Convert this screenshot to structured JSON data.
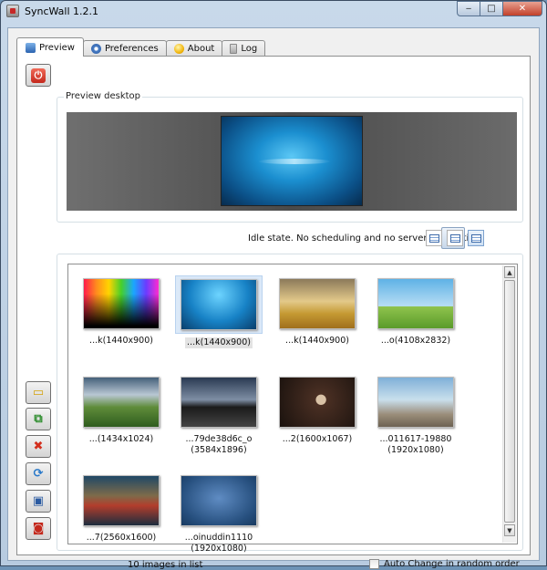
{
  "window": {
    "title": "SyncWall 1.2.1",
    "min": "‒",
    "max": "□",
    "close": "✕"
  },
  "tabs": [
    {
      "label": "Preview",
      "icon": "preview-icon"
    },
    {
      "label": "Preferences",
      "icon": "preferences-icon"
    },
    {
      "label": "About",
      "icon": "about-icon"
    },
    {
      "label": "Log",
      "icon": "log-icon"
    }
  ],
  "preview": {
    "group_label": "Preview desktop"
  },
  "status": {
    "text": "Idle state. No scheduling and no server connection"
  },
  "images": [
    {
      "caption": "...k(1440x900)",
      "selected": false
    },
    {
      "caption": "...k(1440x900)",
      "selected": true
    },
    {
      "caption": "...k(1440x900)",
      "selected": false
    },
    {
      "caption": "...o(4108x2832)",
      "selected": false
    },
    {
      "caption": "...(1434x1024)",
      "selected": false
    },
    {
      "caption": "...79de38d6c_o\n(3584x1896)",
      "selected": false
    },
    {
      "caption": "...2(1600x1067)",
      "selected": false
    },
    {
      "caption": "...011617-19880\n(1920x1080)",
      "selected": false
    },
    {
      "caption": "...7(2560x1600)",
      "selected": false
    },
    {
      "caption": "...oinuddin1110\n(1920x1080)",
      "selected": false
    }
  ],
  "footer": {
    "count": "10 images in list",
    "auto_change": "Auto Change in random order",
    "auto_change_checked": false
  },
  "colors": {
    "accent": "#3d6aa8",
    "stop": "#c4281c"
  }
}
